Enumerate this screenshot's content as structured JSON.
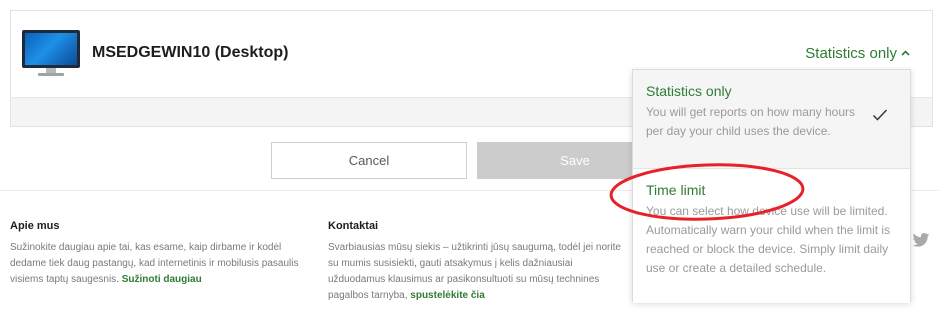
{
  "device": {
    "name": "MSEDGEWIN10 (Desktop)",
    "mode_selected": "Statistics only",
    "mode_chevron_icon": "chevron-up-icon"
  },
  "dropdown": {
    "options": [
      {
        "title": "Statistics only",
        "description": "You will get reports on how many hours per day your child uses the device.",
        "selected": true
      },
      {
        "title": "Time limit",
        "description": "You can select how device use will be limited. Automatically warn your child when the limit is reached or block the device. Simply limit daily use or create a detailed schedule.",
        "selected": false
      }
    ]
  },
  "actions": {
    "cancel_label": "Cancel",
    "save_label": "Save"
  },
  "footer": {
    "about": {
      "heading": "Apie mus",
      "text": "Sužinokite daugiau apie tai, kas esame, kaip dirbame ir kodėl dedame tiek daug pastangų, kad internetinis ir mobilusis pasaulis visiems taptų saugesnis. ",
      "link": "Sužinoti daugiau"
    },
    "contact": {
      "heading": "Kontaktai",
      "text": "Svarbiausias mūsų siekis – užtikrinti jūsų saugumą, todėl jei norite su mumis susisiekti, gauti atsakymus į kelis dažniausiai užduodamus klausimus ar pasikonsultuoti su mūsų technines pagalbos tarnyba, ",
      "link": "spustelėkite čia"
    },
    "social_icon": "twitter-icon"
  },
  "colors": {
    "accent_green": "#2e7d32",
    "annotation_red": "#e8202a",
    "save_disabled": "#cccccc"
  }
}
